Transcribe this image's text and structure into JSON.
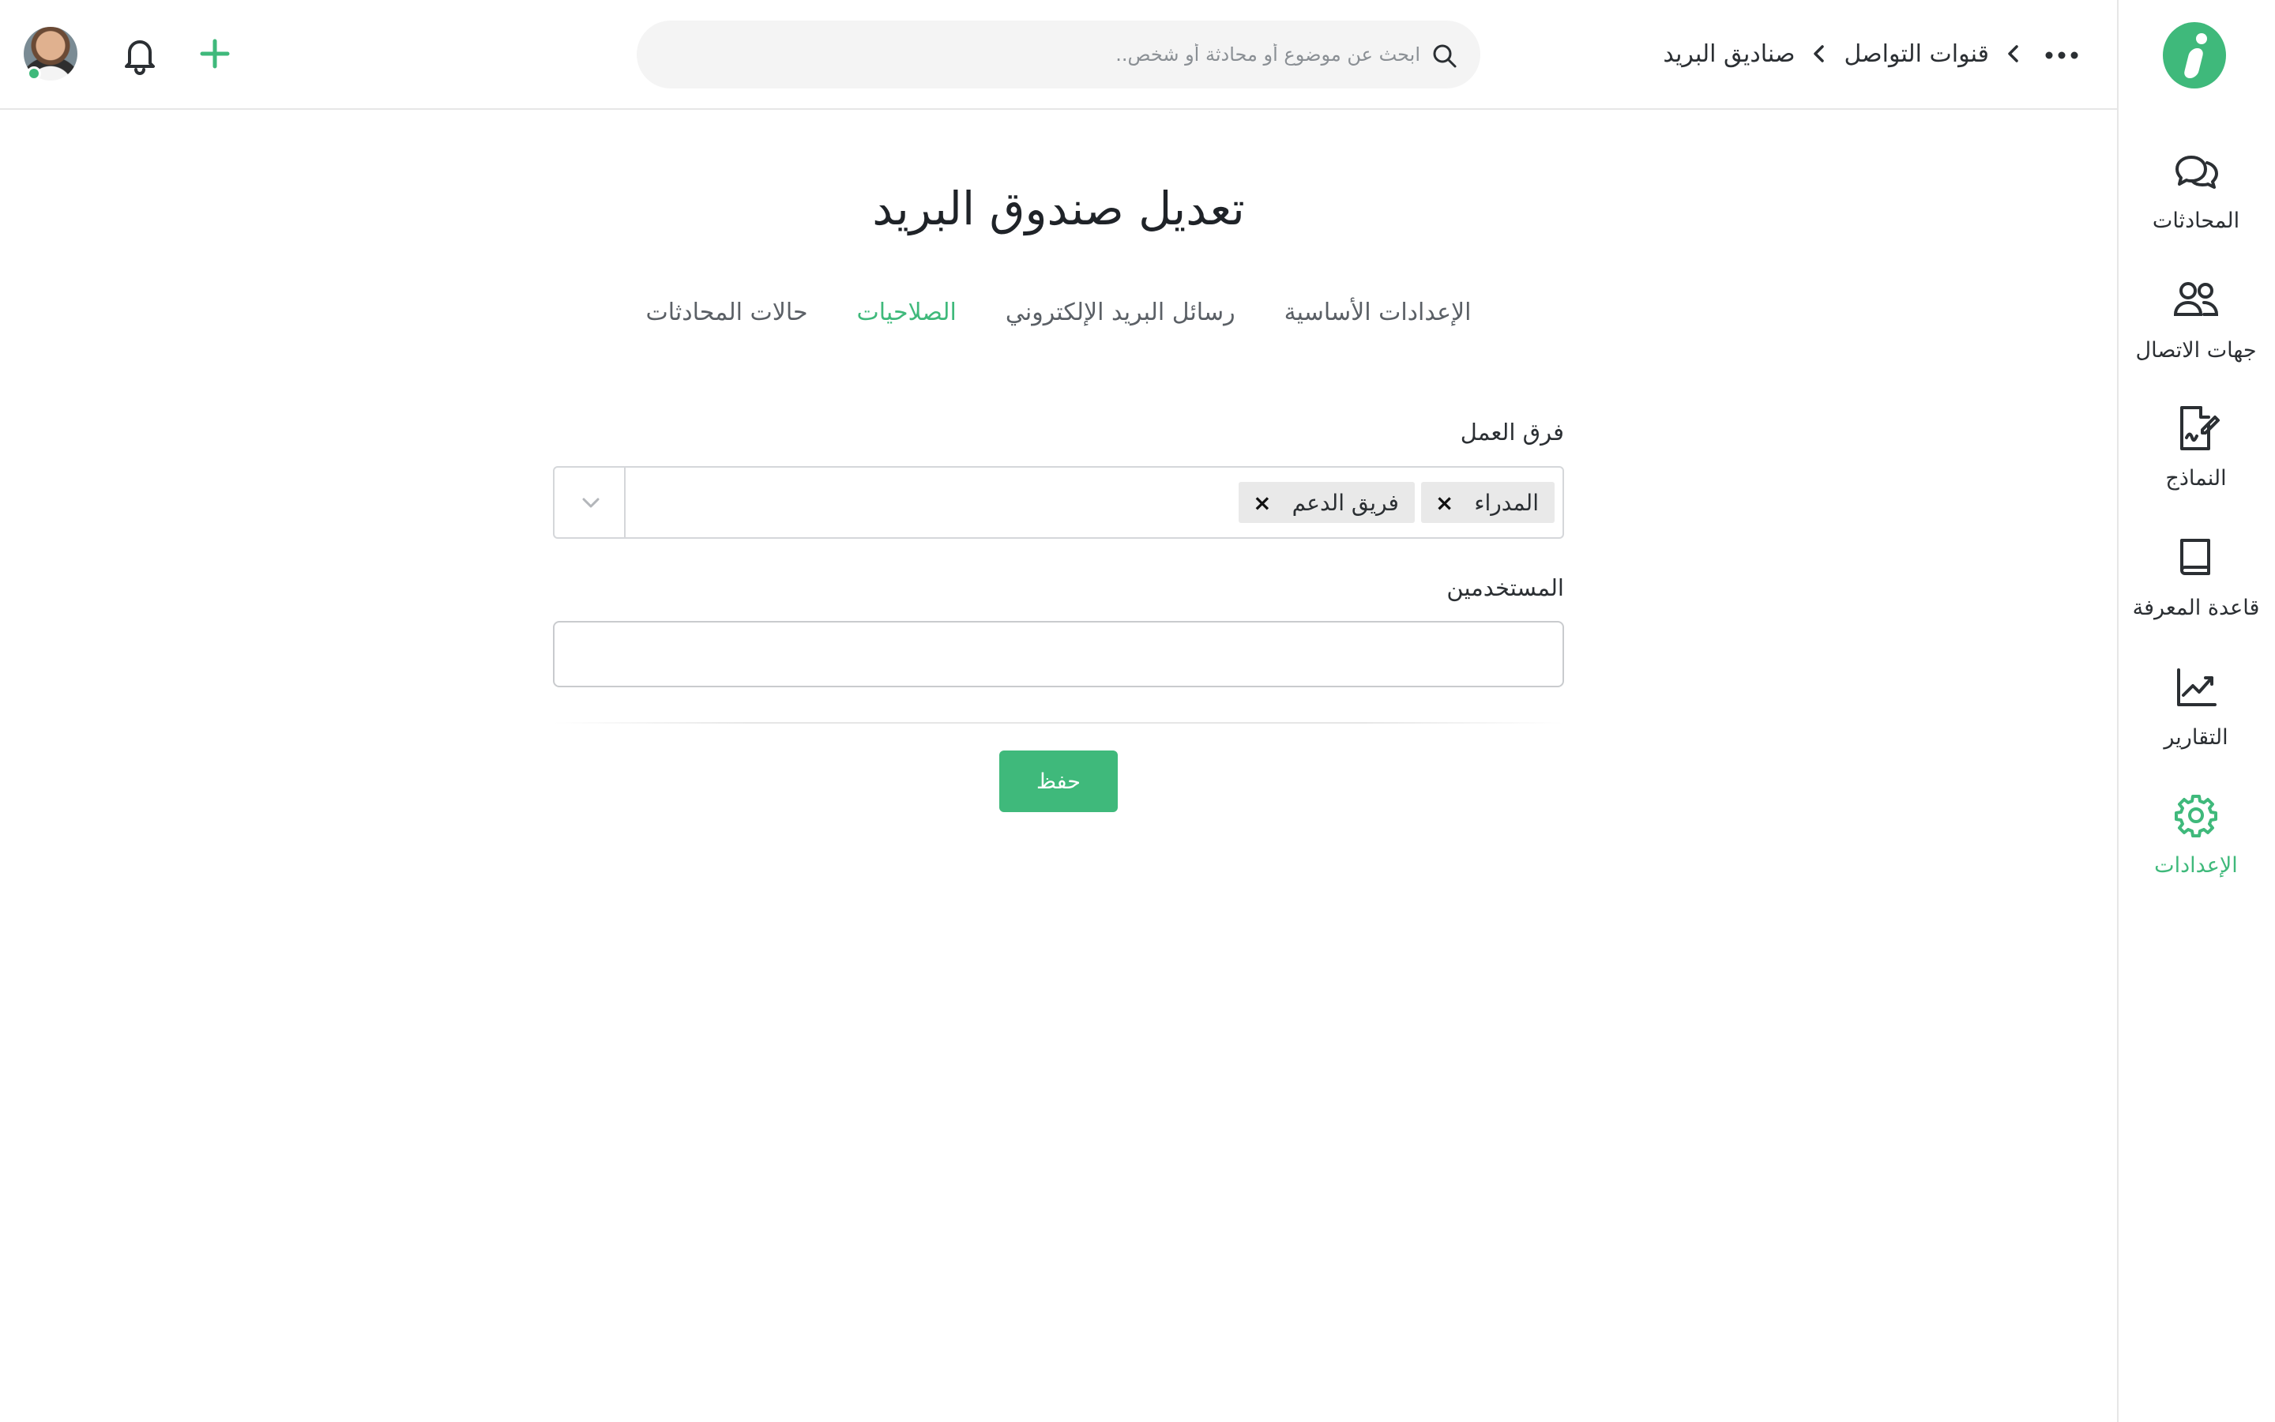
{
  "app": {
    "brand_color": "#3fb97b",
    "logo_icon": "brand-logo-i"
  },
  "sidebar": {
    "items": [
      {
        "label": "المحادثات",
        "icon": "chat-bubbles-icon",
        "active": false
      },
      {
        "label": "جهات الاتصال",
        "icon": "contacts-icon",
        "active": false
      },
      {
        "label": "النماذج",
        "icon": "form-signature-icon",
        "active": false
      },
      {
        "label": "قاعدة المعرفة",
        "icon": "book-icon",
        "active": false
      },
      {
        "label": "التقارير",
        "icon": "chart-trend-icon",
        "active": false
      },
      {
        "label": "الإعدادات",
        "icon": "gear-icon",
        "active": true
      }
    ]
  },
  "header": {
    "breadcrumb": [
      "قنوات التواصل",
      "صناديق البريد"
    ],
    "search_placeholder": "ابحث عن موضوع أو محادثة أو شخص..",
    "user_status": "online"
  },
  "main": {
    "title": "تعديل صندوق البريد",
    "tabs": [
      {
        "label": "الإعدادات الأساسية",
        "active": false
      },
      {
        "label": "رسائل البريد الإلكتروني",
        "active": false
      },
      {
        "label": "الصلاحيات",
        "active": true
      },
      {
        "label": "حالات المحادثات",
        "active": false
      }
    ],
    "teams_label": "فرق العمل",
    "teams_selected": [
      "المدراء",
      "فريق الدعم"
    ],
    "tag_remove_symbol": "×",
    "users_label": "المستخدمين",
    "users_value": "",
    "save_label": "حفظ"
  }
}
